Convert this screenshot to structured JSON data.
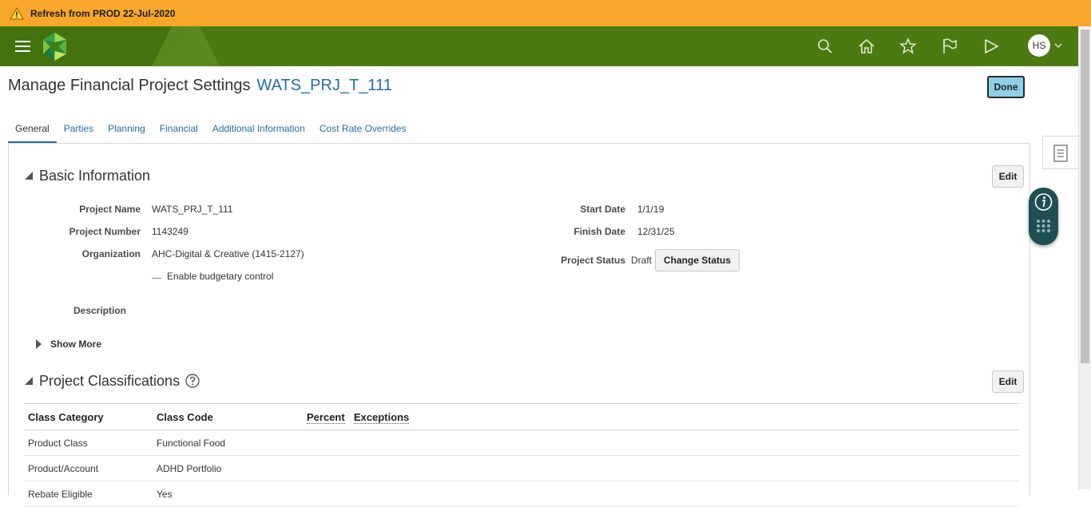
{
  "banner": {
    "text": "Refresh from PROD 22-Jul-2020",
    "color": "#f9a72b"
  },
  "header": {
    "brand_color": "#4b7a12",
    "icons": [
      "menu-icon",
      "logo-icon",
      "search-icon",
      "home-icon",
      "star-icon",
      "flag-icon",
      "share-icon"
    ],
    "user_initials": "HS"
  },
  "page": {
    "title": "Manage Financial Project Settings",
    "project_link": "WATS_PRJ_T_111",
    "done_label": "Done"
  },
  "tabs": [
    {
      "label": "General",
      "active": true
    },
    {
      "label": "Parties"
    },
    {
      "label": "Planning"
    },
    {
      "label": "Financial"
    },
    {
      "label": "Additional Information"
    },
    {
      "label": "Cost Rate Overrides"
    }
  ],
  "basic_info": {
    "title": "Basic Information",
    "edit_label": "Edit",
    "fields": {
      "project_name": {
        "label": "Project Name",
        "value": "WATS_PRJ_T_111"
      },
      "project_number": {
        "label": "Project Number",
        "value": "1143249"
      },
      "organization": {
        "label": "Organization",
        "value": "AHC-Digital & Creative (1415-2127)"
      },
      "budgetary": {
        "label": "Enable budgetary control"
      },
      "description": {
        "label": "Description",
        "value": ""
      },
      "start_date": {
        "label": "Start Date",
        "value": "1/1/19"
      },
      "finish_date": {
        "label": "Finish Date",
        "value": "12/31/25"
      },
      "project_status": {
        "label": "Project Status",
        "value": "Draft"
      }
    },
    "change_status_label": "Change Status",
    "show_more_label": "Show More"
  },
  "classifications": {
    "title": "Project Classifications",
    "edit_label": "Edit",
    "columns": [
      "Class Category",
      "Class Code",
      "Percent",
      "Exceptions"
    ],
    "rows": [
      {
        "category": "Product Class",
        "code": "Functional Food"
      },
      {
        "category": "Product/Account",
        "code": "ADHD Portfolio"
      },
      {
        "category": "Rebate Eligible",
        "code": "Yes"
      }
    ]
  }
}
